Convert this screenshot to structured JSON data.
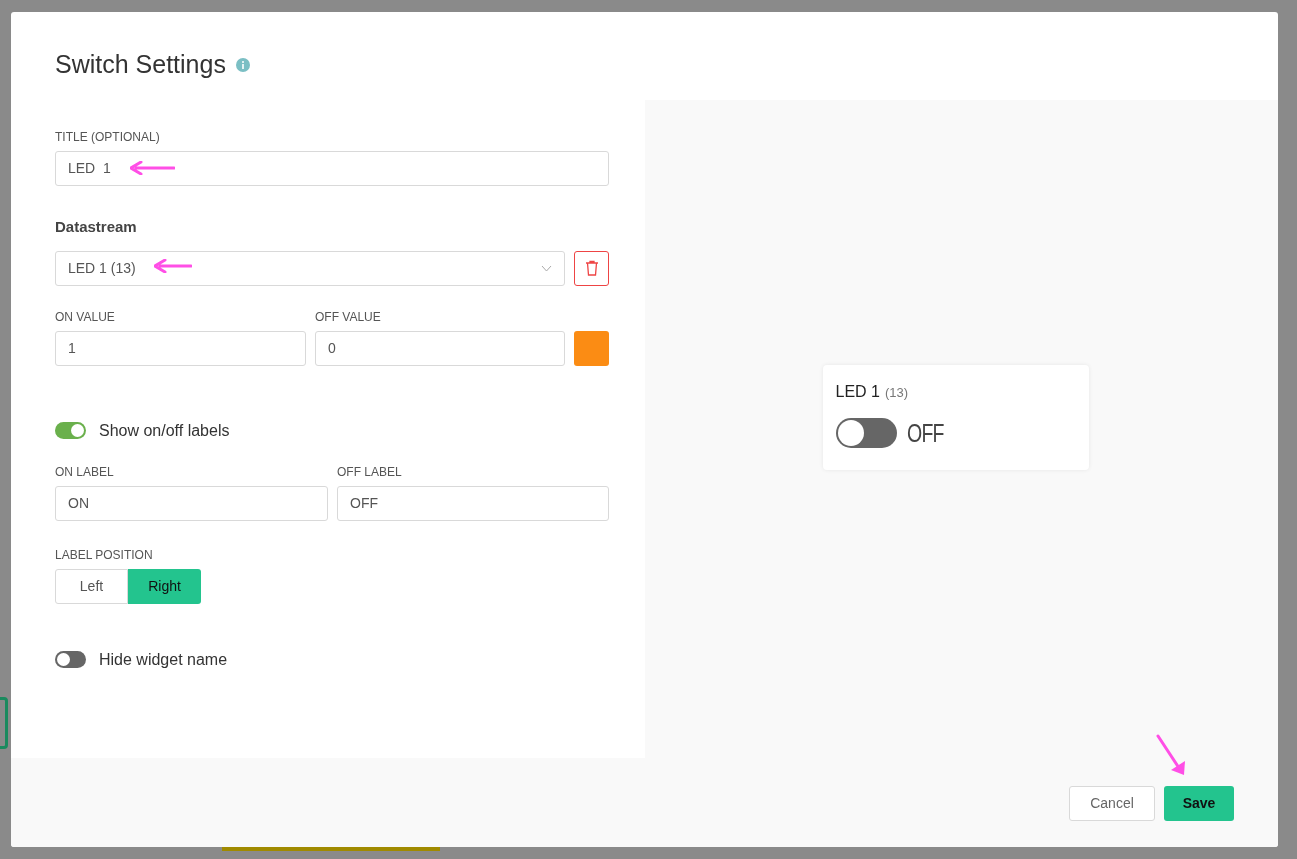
{
  "dialog": {
    "title": "Switch Settings"
  },
  "form": {
    "title_field": {
      "label": "TITLE (OPTIONAL)",
      "value": "LED  1"
    },
    "datastream": {
      "heading": "Datastream",
      "value": "LED 1 (13)"
    },
    "on_value": {
      "label": "ON VALUE",
      "value": "1"
    },
    "off_value": {
      "label": "OFF VALUE",
      "value": "0"
    },
    "color": "#fb8c14",
    "show_labels": {
      "label": "Show on/off labels",
      "on": true
    },
    "on_label": {
      "label": "ON LABEL",
      "value": "ON"
    },
    "off_label": {
      "label": "OFF LABEL",
      "value": "OFF"
    },
    "label_position": {
      "label": "LABEL POSITION",
      "options": [
        {
          "label": "Left",
          "selected": false
        },
        {
          "label": "Right",
          "selected": true
        }
      ]
    },
    "hide_name": {
      "label": "Hide widget name",
      "on": false
    }
  },
  "preview": {
    "name": "LED 1",
    "pin": "(13)",
    "on": false,
    "state_label": "OFF"
  },
  "buttons": [
    {
      "label": "Cancel",
      "kind": "secondary"
    },
    {
      "label": "Save",
      "kind": "primary"
    }
  ]
}
